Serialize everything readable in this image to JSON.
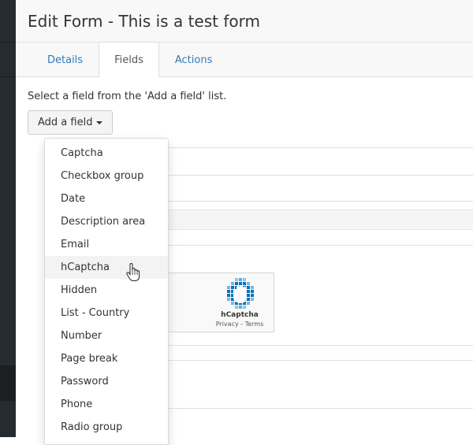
{
  "header": {
    "title": "Edit Form - This is a test form"
  },
  "tabs": [
    {
      "label": "Details",
      "active": false
    },
    {
      "label": "Fields",
      "active": true
    },
    {
      "label": "Actions",
      "active": false
    }
  ],
  "content": {
    "hint": "Select a field from the 'Add a field' list.",
    "add_field_label": "Add a field"
  },
  "dropdown": {
    "items": [
      "Captcha",
      "Checkbox group",
      "Date",
      "Description area",
      "Email",
      "hCaptcha",
      "Hidden",
      "List - Country",
      "Number",
      "Page break",
      "Password",
      "Phone",
      "Radio group"
    ],
    "hovered_item": "hCaptcha"
  },
  "hcaptcha_widget": {
    "name": "hCaptcha",
    "privacy": "Privacy",
    "separator": "-",
    "terms": "Terms"
  },
  "colors": {
    "link": "#337ab7",
    "sidebar": "#262b2f",
    "hcaptcha_blue": "#0074bf",
    "hcaptcha_teal": "#00c9c9"
  }
}
